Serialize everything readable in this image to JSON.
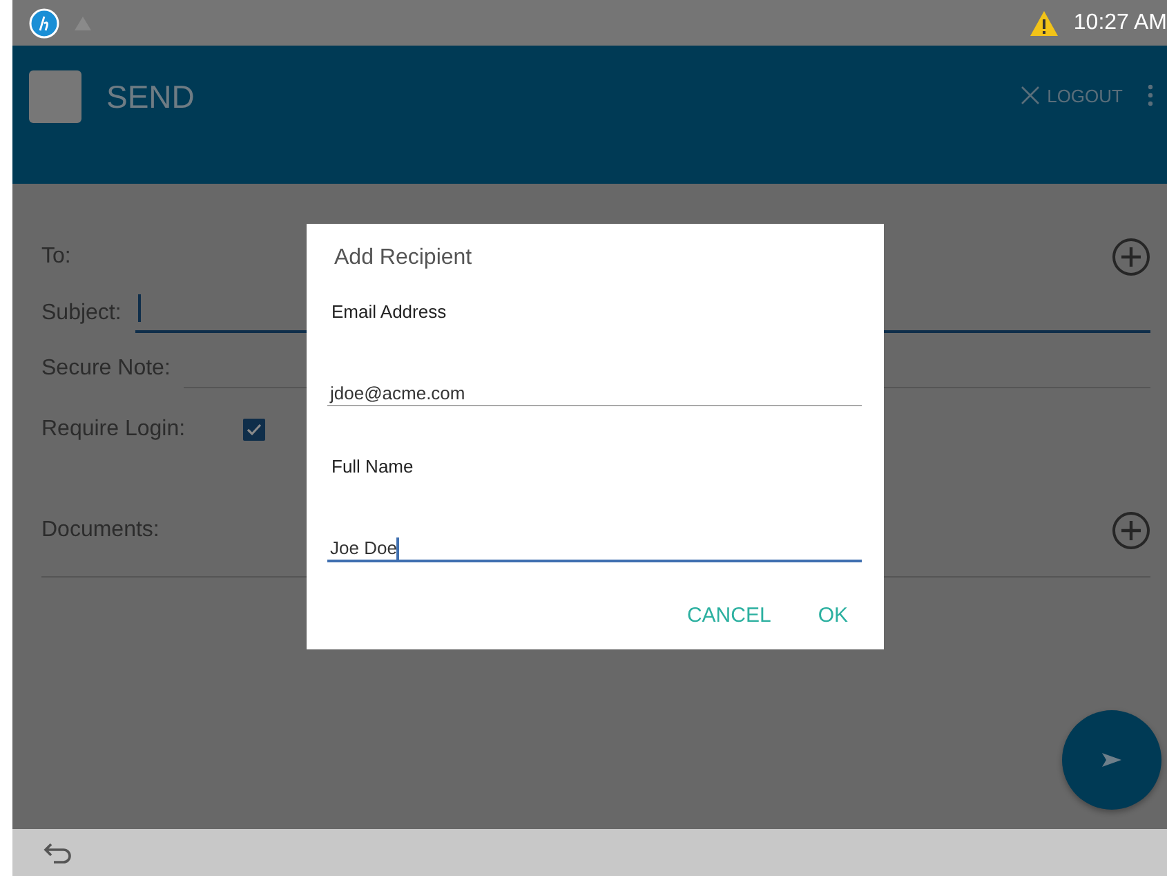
{
  "status_bar": {
    "time": "10:27 AM"
  },
  "app_bar": {
    "title": "SEND",
    "actions": [
      {
        "kind": "logout",
        "label": "LOGOUT"
      },
      {
        "kind": "more"
      }
    ]
  },
  "form": {
    "rows": [
      {
        "kind": "recipient",
        "label": "To:"
      },
      {
        "kind": "text",
        "label": "Subject:",
        "focused": true
      },
      {
        "kind": "text",
        "label": "Secure Note:",
        "focused": false
      },
      {
        "kind": "checkbox",
        "label": "Require Login:",
        "checked": true
      },
      {
        "kind": "attachment",
        "label": "Documents:"
      }
    ]
  },
  "dialog": {
    "title": "Add Recipient",
    "fields": [
      {
        "label": "Email Address",
        "value": "jdoe@acme.com",
        "focused": false
      },
      {
        "label": "Full Name",
        "value": "Joe Doe",
        "focused": true
      }
    ],
    "buttons": [
      "CANCEL",
      "OK"
    ]
  }
}
